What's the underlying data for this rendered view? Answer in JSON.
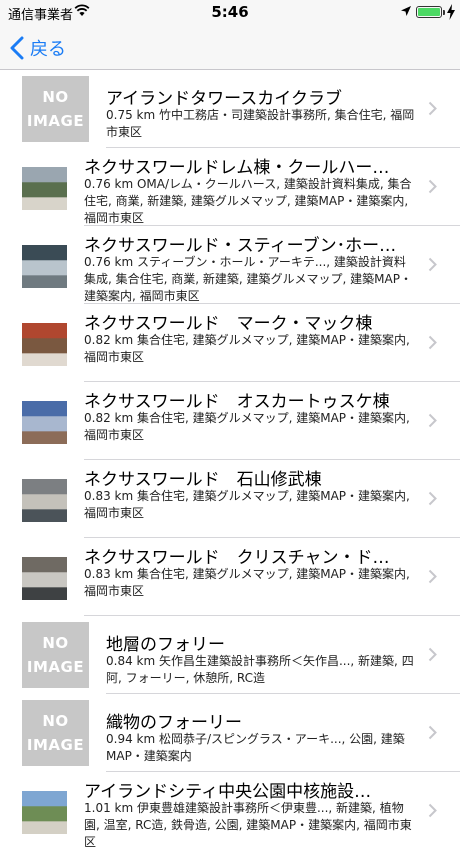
{
  "status": {
    "carrier": "通信事業者",
    "time": "5:46",
    "battery_level": 1.0
  },
  "nav": {
    "back_label": "戻る"
  },
  "noimage": {
    "line1": "NO",
    "line2": "IMAGE"
  },
  "items": [
    {
      "title": "アイランドタワースカイクラブ",
      "detail": "0.75 km 竹中工務店・司建築設計事務所, 集合住宅, 福岡市東区",
      "thumb": "none"
    },
    {
      "title": "ネクサスワールドレム棟・クールハー…",
      "detail": "0.76 km OMA/レム・クールハース, 建築設計資料集成, 集合住宅, 商業, 新建築, 建築グルメマップ, 建築MAP・建築案内, 福岡市東区",
      "thumb": "photo"
    },
    {
      "title": "ネクサスワールド・スティーブン･ホー…",
      "detail": "0.76 km スティーブン・ホール・アーキテ..., 建築設計資料集成, 集合住宅, 商業, 新建築, 建築グルメマップ, 建築MAP・建築案内, 福岡市東区",
      "thumb": "photo"
    },
    {
      "title": "ネクサスワールド　マーク・マック棟",
      "detail": "0.82 km 集合住宅, 建築グルメマップ, 建築MAP・建築案内, 福岡市東区",
      "thumb": "photo"
    },
    {
      "title": "ネクサスワールド　オスカートゥスケ棟",
      "detail": "0.82 km 集合住宅, 建築グルメマップ, 建築MAP・建築案内, 福岡市東区",
      "thumb": "photo"
    },
    {
      "title": "ネクサスワールド　石山修武棟",
      "detail": "0.83 km 集合住宅, 建築グルメマップ, 建築MAP・建築案内, 福岡市東区",
      "thumb": "photo"
    },
    {
      "title": "ネクサスワールド　クリスチャン・ド…",
      "detail": "0.83 km 集合住宅, 建築グルメマップ, 建築MAP・建築案内, 福岡市東区",
      "thumb": "photo"
    },
    {
      "title": "地層のフォリー",
      "detail": "0.84 km 矢作昌生建築設計事務所＜矢作昌..., 新建築, 四阿, フォーリー, 休憩所, RC造",
      "thumb": "none"
    },
    {
      "title": "織物のフォーリー",
      "detail": "0.94 km 松岡恭子/スピングラス・アーキ..., 公園, 建築MAP・建築案内",
      "thumb": "none"
    },
    {
      "title": "アイランドシティ中央公園中核施設…",
      "detail": "1.01 km 伊東豊雄建築設計事務所＜伊東豊..., 新建築, 植物園, 温室, RC造, 鉄骨造, 公園, 建築MAP・建築案内, 福岡市東区",
      "thumb": "photo"
    }
  ],
  "colors": {
    "accent": "#1a7cf5",
    "noimage_bg": "#c7c7c7",
    "battery": "#4cd964",
    "separator": "#d6d6da",
    "chevron": "#c7c7cc"
  }
}
